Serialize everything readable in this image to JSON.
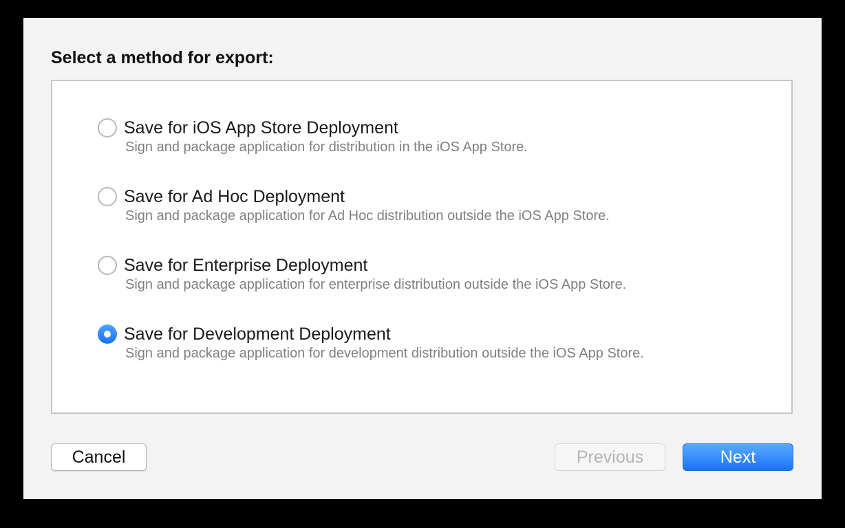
{
  "dialog": {
    "heading": "Select a method for export:"
  },
  "options": [
    {
      "title": "Save for iOS App Store Deployment",
      "description": "Sign and package application for distribution in the iOS App Store.",
      "selected": false
    },
    {
      "title": "Save for Ad Hoc Deployment",
      "description": "Sign and package application for Ad Hoc distribution outside the iOS App Store.",
      "selected": false
    },
    {
      "title": "Save for Enterprise Deployment",
      "description": "Sign and package application for enterprise distribution outside the iOS App Store.",
      "selected": false
    },
    {
      "title": "Save for Development Deployment",
      "description": "Sign and package application for development distribution outside the iOS App Store.",
      "selected": true
    }
  ],
  "buttons": {
    "cancel_label": "Cancel",
    "previous_label": "Previous",
    "previous_enabled": false,
    "next_label": "Next"
  },
  "colors": {
    "accent": "#1a74f4",
    "sheet_background": "#f3f3f3",
    "disabled_text": "#b5b5b5"
  }
}
